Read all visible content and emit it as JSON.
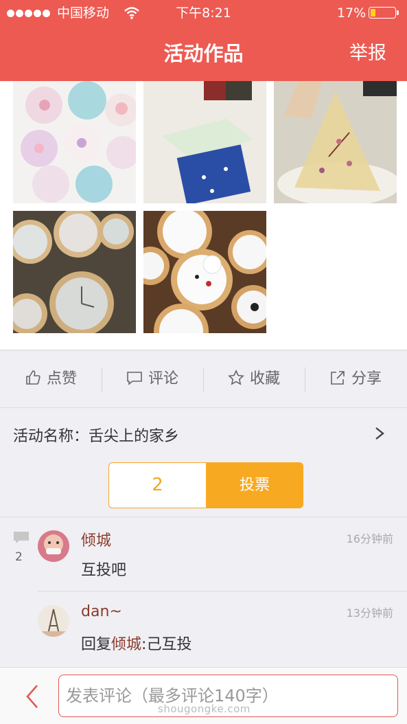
{
  "status": {
    "carrier": "中国移动",
    "time": "下午8:21",
    "battery": "17%"
  },
  "nav": {
    "title": "活动作品",
    "report": "举报"
  },
  "gallery": {
    "photos": [
      "cupcakes-photo",
      "jelly-dessert-photo",
      "pyramid-jelly-photo",
      "clock-cookies-photo",
      "snowman-cookies-photo"
    ]
  },
  "actions": {
    "like": "点赞",
    "comment": "评论",
    "favorite": "收藏",
    "share": "分享"
  },
  "event": {
    "name": "活动名称：舌尖上的家乡"
  },
  "vote": {
    "count": "2",
    "button": "投票"
  },
  "comments": {
    "count": "2",
    "items": [
      {
        "user": "倾城",
        "time": "16分钟前",
        "text": "互投吧"
      },
      {
        "user": "dan~",
        "time": "13分钟前",
        "reply_prefix": "回复",
        "reply_to": "倾城",
        "reply_text": ":己互投"
      }
    ]
  },
  "input": {
    "placeholder": "发表评论（最多评论140字）"
  },
  "watermark": "shougongke.com",
  "colors": {
    "brand": "#ed5a52",
    "vote": "#f8a922"
  }
}
